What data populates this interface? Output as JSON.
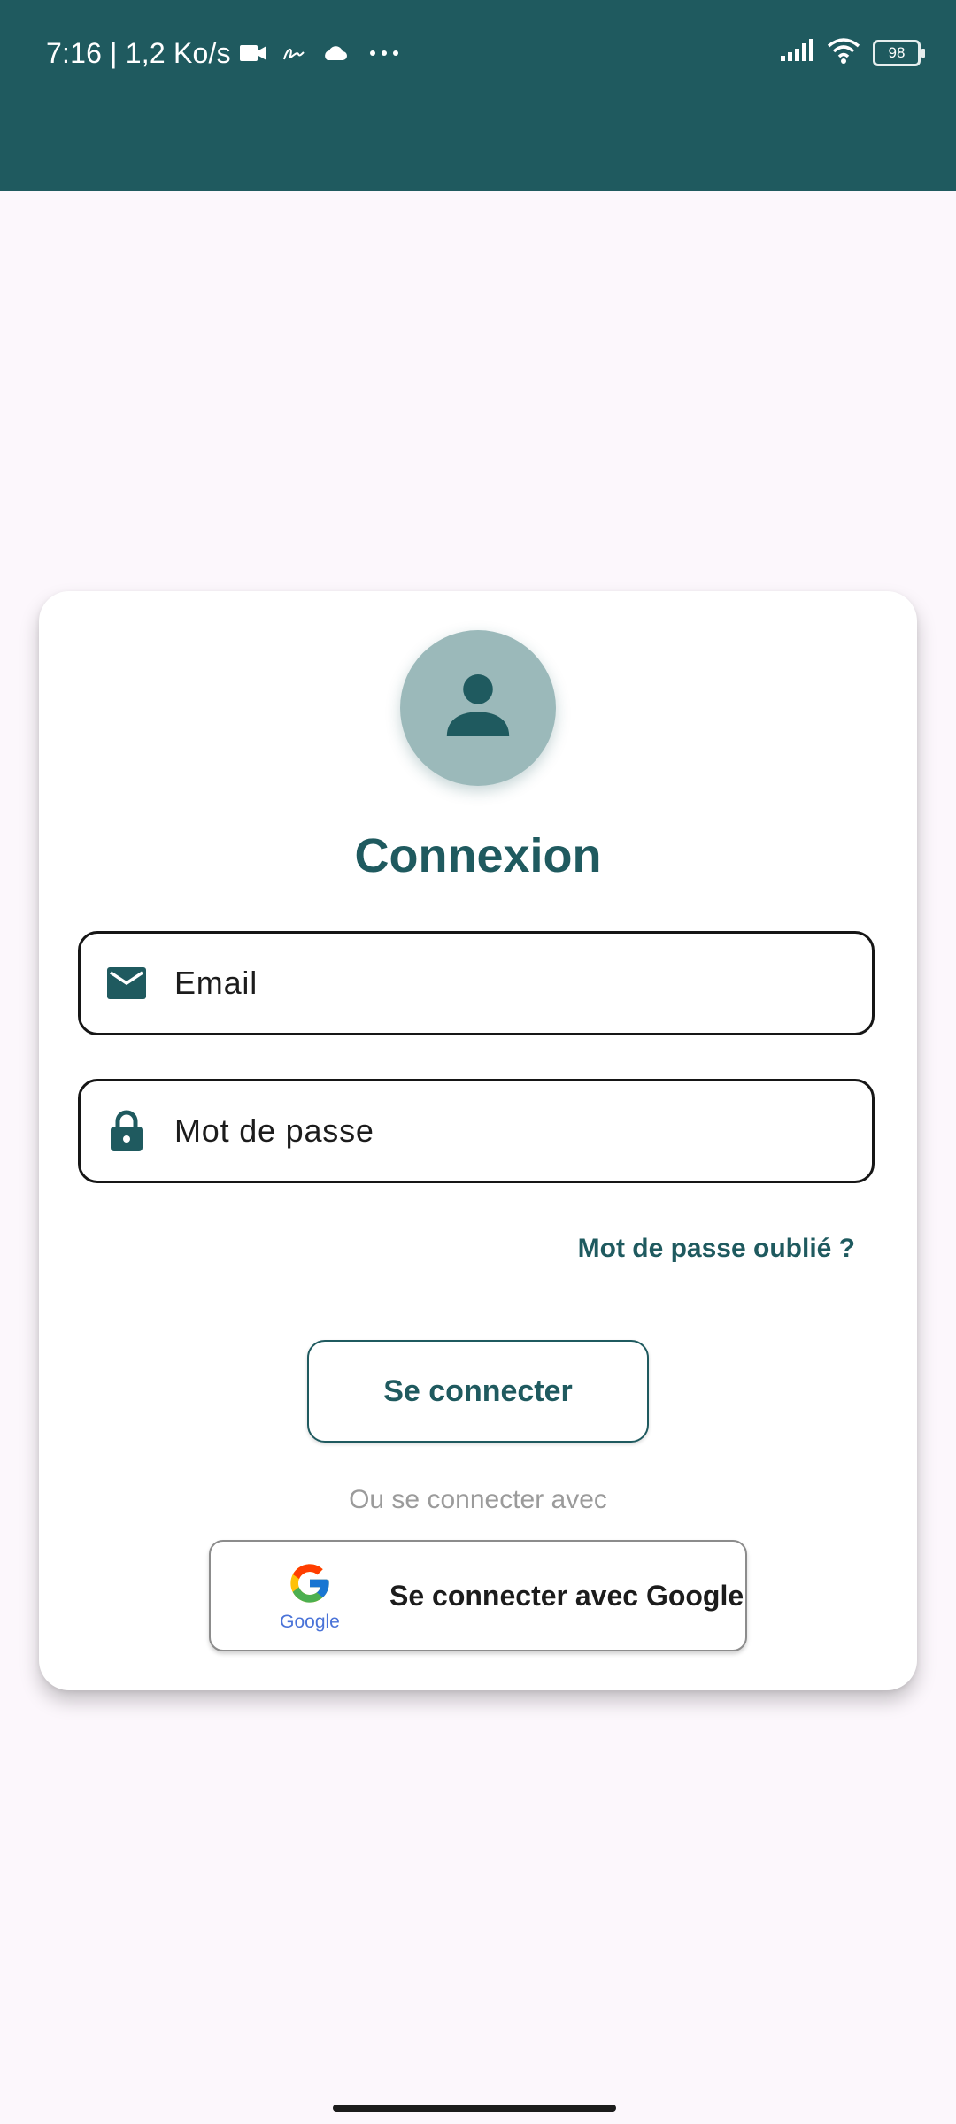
{
  "status_bar": {
    "time_and_speed": "7:16 | 1,2 Ko/s",
    "icons_left": [
      "video-camera-icon",
      "signature-icon",
      "cloud-icon",
      "more-icon"
    ],
    "icons_right": [
      "signal-icon",
      "wifi-icon",
      "battery-icon"
    ],
    "battery_level": "98"
  },
  "colors": {
    "primary": "#1f5a5f",
    "avatar_bg": "#9bb9ba",
    "page_bg": "#fcf7fc",
    "muted_text": "#9b9b9b"
  },
  "login_card": {
    "avatar_icon": "person-icon",
    "title": "Connexion",
    "email_field": {
      "icon": "mail-icon",
      "placeholder": "Email",
      "value": ""
    },
    "password_field": {
      "icon": "lock-icon",
      "placeholder": "Mot de passe",
      "value": ""
    },
    "forgot_password_label": "Mot de passe oublié ?",
    "login_button_label": "Se connecter",
    "alternate_login_text": "Ou se connecter avec",
    "google_button": {
      "logo_word": "Google",
      "label": "Se connecter avec Google"
    }
  }
}
